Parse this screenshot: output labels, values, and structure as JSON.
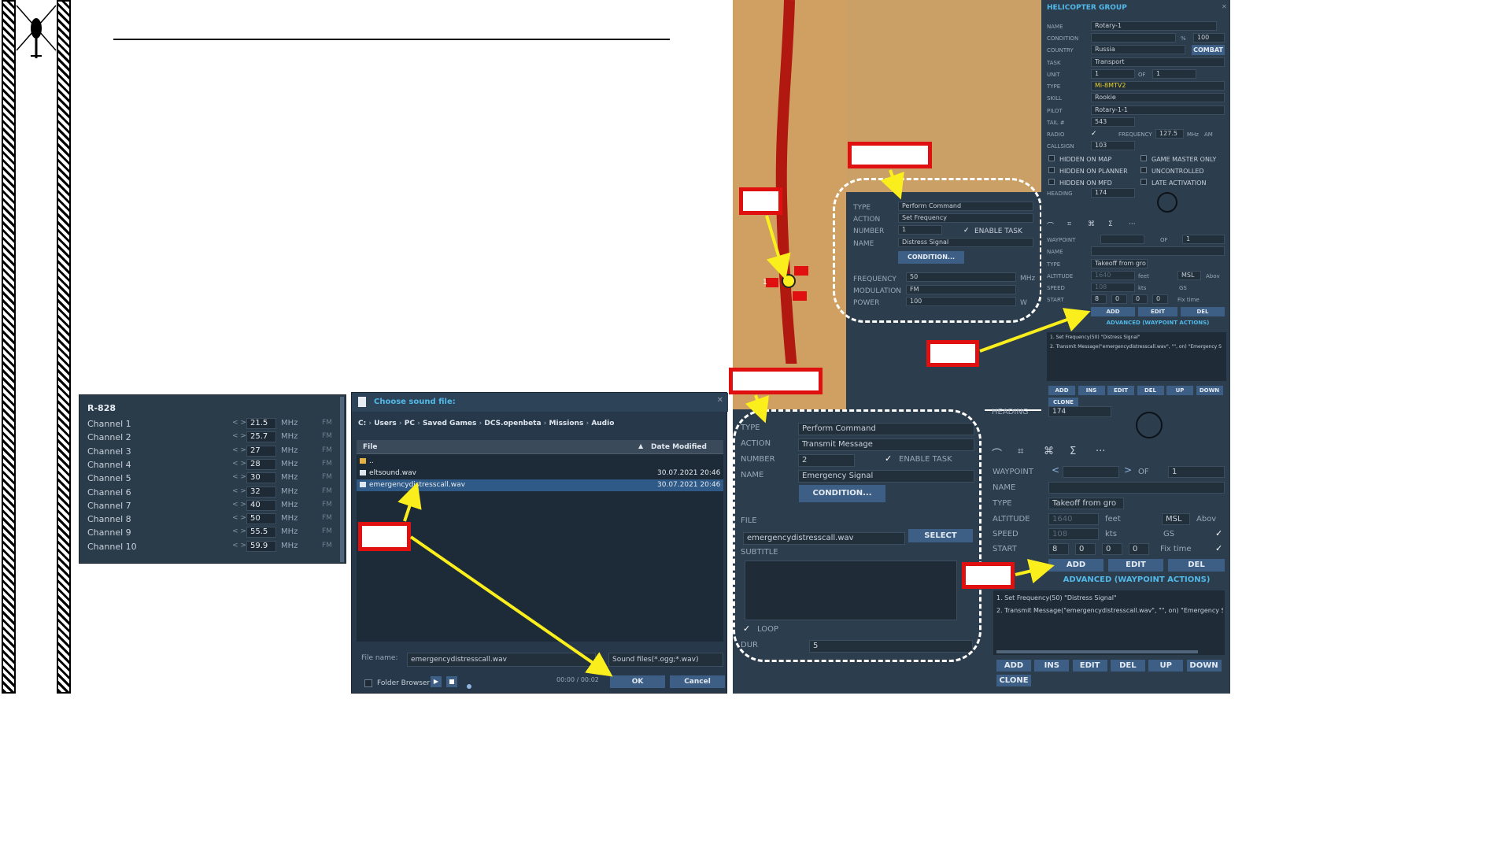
{
  "radio": {
    "title": "R-828",
    "unit": "MHz",
    "mod": "FM",
    "channels": [
      {
        "label": "Channel 1",
        "value": "21.5"
      },
      {
        "label": "Channel 2",
        "value": "25.7"
      },
      {
        "label": "Channel 3",
        "value": "27"
      },
      {
        "label": "Channel 4",
        "value": "28"
      },
      {
        "label": "Channel 5",
        "value": "30"
      },
      {
        "label": "Channel 6",
        "value": "32"
      },
      {
        "label": "Channel 7",
        "value": "40"
      },
      {
        "label": "Channel 8",
        "value": "50"
      },
      {
        "label": "Channel 9",
        "value": "55.5"
      },
      {
        "label": "Channel 10",
        "value": "59.9"
      }
    ]
  },
  "file_dialog": {
    "title": "Choose sound file:",
    "path": [
      "C:",
      "Users",
      "PC",
      "Saved Games",
      "DCS.openbeta",
      "Missions",
      "Audio"
    ],
    "col_file": "File",
    "col_date": "Date Modified",
    "rows": [
      {
        "name": "..",
        "date": ""
      },
      {
        "name": "eltsound.wav",
        "date": "30.07.2021 20:46"
      },
      {
        "name": "emergencydistresscall.wav",
        "date": "30.07.2021 20:46"
      }
    ],
    "filename_label": "File name:",
    "filename_value": "emergencydistresscall.wav",
    "filter": "Sound files(*.ogg;*.wav)",
    "folder_browser": "Folder Browser",
    "time": "00:00 / 00:02",
    "ok": "OK",
    "cancel": "Cancel"
  },
  "group": {
    "title": "HELICOPTER GROUP",
    "name_label": "NAME",
    "name": "Rotary-1",
    "condition_label": "CONDITION",
    "condition_pct": "%",
    "condition_val": "100",
    "country_label": "COUNTRY",
    "country": "Russia",
    "combat": "COMBAT",
    "task_label": "TASK",
    "task": "Transport",
    "unit_label": "UNIT",
    "unit": "1",
    "of": "OF",
    "unit_of": "1",
    "type_label": "TYPE",
    "type": "Mi-8MTV2",
    "skill_label": "SKILL",
    "skill": "Rookie",
    "pilot_label": "PILOT",
    "pilot": "Rotary-1-1",
    "tail_label": "TAIL #",
    "tail": "543",
    "radio_label": "RADIO",
    "freq_label": "FREQUENCY",
    "freq": "127.5",
    "mhz": "MHz",
    "am": "AM",
    "callsign_label": "CALLSIGN",
    "callsign": "103",
    "hidden_map": "HIDDEN ON MAP",
    "gm_only": "GAME MASTER ONLY",
    "hidden_planner": "HIDDEN ON PLANNER",
    "uncontrolled": "UNCONTROLLED",
    "hidden_mfd": "HIDDEN ON MFD",
    "late": "LATE ACTIVATION",
    "heading_label": "HEADING",
    "heading": "174"
  },
  "task1": {
    "type_label": "TYPE",
    "type": "Perform Command",
    "action_label": "ACTION",
    "action": "Set Frequency",
    "number_label": "NUMBER",
    "number": "1",
    "enable": "ENABLE TASK",
    "name_label": "NAME",
    "name": "Distress Signal",
    "condition_btn": "CONDITION...",
    "freq_label": "FREQUENCY",
    "freq": "50",
    "mhz": "MHz",
    "mod_label": "MODULATION",
    "mod": "FM",
    "power_label": "POWER",
    "power": "100",
    "w": "W"
  },
  "task2": {
    "type_label": "TYPE",
    "type": "Perform Command",
    "action_label": "ACTION",
    "action": "Transmit Message",
    "number_label": "NUMBER",
    "number": "2",
    "enable": "ENABLE TASK",
    "name_label": "NAME",
    "name": "Emergency Signal",
    "condition_btn": "CONDITION...",
    "file_label": "FILE",
    "file": "emergencydistresscall.wav",
    "select": "SELECT",
    "subtitle_label": "SUBTITLE",
    "loop": "LOOP",
    "dur_label": "DUR",
    "dur": "5"
  },
  "waypoint": {
    "waypoint_label": "WAYPOINT",
    "of": "OF",
    "total": "1",
    "name_label": "NAME",
    "type_label": "TYPE",
    "type": "Takeoff from gro",
    "alt_label": "ALTITUDE",
    "alt": "1640",
    "feet": "feet",
    "msl": "MSL",
    "above": "Abov",
    "speed_label": "SPEED",
    "speed": "108",
    "kts": "kts",
    "gs": "GS",
    "start_label": "START",
    "h": "8",
    "m": "0",
    "s": "0",
    "d": "0",
    "fix": "Fix time",
    "add": "ADD",
    "edit": "EDIT",
    "del": "DEL",
    "adv": "ADVANCED (WAYPOINT ACTIONS)",
    "actions": [
      "1. Set Frequency(50) \"Distress Signal\"",
      "2. Transmit Message(\"emergencydistresscall.wav\", \"\", on) \"Emergency S"
    ],
    "b_add": "ADD",
    "b_ins": "INS",
    "b_edit": "EDIT",
    "b_del": "DEL",
    "b_up": "UP",
    "b_down": "DOWN",
    "b_clone": "CLONE"
  },
  "map": {
    "unit_num": "1"
  },
  "heading_small": "HEADING",
  "heading_small_val": "174",
  "colors": {
    "panel": "#2c3d4d",
    "field": "#22303c",
    "button": "#3d5f86",
    "accent": "#fbee1d",
    "red": "#e01010",
    "title_blue": "#52b8e8",
    "sand": "#d0a062",
    "road": "#b01810"
  }
}
